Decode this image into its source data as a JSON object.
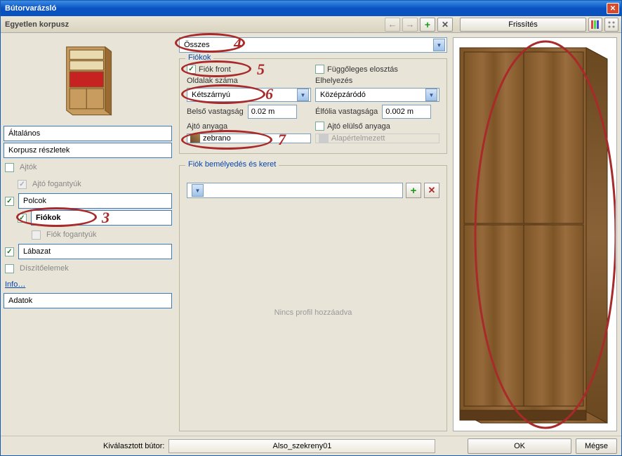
{
  "window": {
    "title": "Bútorvarázsló"
  },
  "toolbar": {
    "subtitle": "Egyetlen korpusz",
    "refresh": "Frissítés"
  },
  "nav": {
    "altalanos": "Általános",
    "korpusz": "Korpusz részletek",
    "ajtok": "Ajtók",
    "ajto_fogantyuk": "Ajtó fogantyúk",
    "polcok": "Polcok",
    "fiokok": "Fiókok",
    "fiok_fogantyuk": "Fiók fogantyúk",
    "labazat": "Lábazat",
    "diszito": "Díszítőelemek",
    "info": "Info…",
    "adatok": "Adatok"
  },
  "combo_all": "Összes",
  "fiokok": {
    "legend": "Fiókok",
    "fiok_front": "Fiók front",
    "fugg_elosztas": "Függőleges elosztás",
    "oldalak_szama": "Oldalak száma",
    "oldalak_value": "Kétszárnyú",
    "elhelyezes": "Elhelyezés",
    "elhelyezes_value": "Középzáródó",
    "belso_vastagsag": "Belső vastagság",
    "belso_value": "0.02 m",
    "elfolia_vastagsaga": "Élfólia vastagsága",
    "elfolia_value": "0.002 m",
    "ajto_anyaga": "Ajtó anyaga",
    "ajto_anyaga_value": "zebrano",
    "ajto_elulso": "Ajtó elülső anyaga",
    "ajto_elulso_value": "Alapértelmezett"
  },
  "keret": {
    "legend": "Fiók bemélyedés és keret",
    "empty": "Nincs profil hozzáadva"
  },
  "footer": {
    "label": "Kiválasztott bútor:",
    "name": "Also_szekreny01",
    "ok": "OK",
    "cancel": "Mégse"
  },
  "annotations": {
    "n3": "3",
    "n4": "4",
    "n5": "5",
    "n6": "6",
    "n7": "7"
  }
}
